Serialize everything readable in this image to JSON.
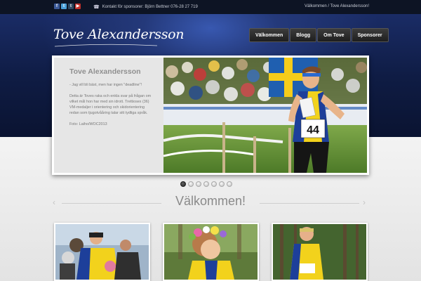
{
  "topbar": {
    "social_icons": [
      {
        "name": "facebook-icon",
        "glyph": "f"
      },
      {
        "name": "twitter-icon",
        "glyph": "t"
      },
      {
        "name": "tumblr-icon",
        "glyph": "t"
      },
      {
        "name": "youtube-icon",
        "glyph": "▶"
      }
    ],
    "contact_text": "Kontakt för sponsorer: Björn Bettner 076-28 27 719",
    "breadcrumb": "Välkommen / Tove Alexandersson!"
  },
  "header": {
    "logo_text": "Tove Alexandersson"
  },
  "nav": {
    "items": [
      "Välkommen",
      "Blogg",
      "Om Tove",
      "Sponsorer"
    ]
  },
  "slider": {
    "title": "Tove Alexandersson",
    "paragraph1": "- Jag vill bli bäst, men har ingen \"deadline\"!",
    "paragraph2": "Detta är Toves raka och enkla svar på frågan om vilket mål hon har med sin idrott. Trettiosex (36) VM-medaljer i orientering och skidorientering redan som tjugotvååring talar sitt tydliga språk.",
    "credit": "Foto: Laiho/WOC2013",
    "bib_number": "44",
    "slide_count": 7,
    "active_slide": 1
  },
  "welcome": {
    "heading": "Välkommen!"
  },
  "colors": {
    "topbar": "#0d1424",
    "header_blue": "#24397a",
    "nav_dark": "#2a2a2a",
    "jersey_yellow": "#f2d21c",
    "jersey_blue": "#1d3f9a"
  }
}
